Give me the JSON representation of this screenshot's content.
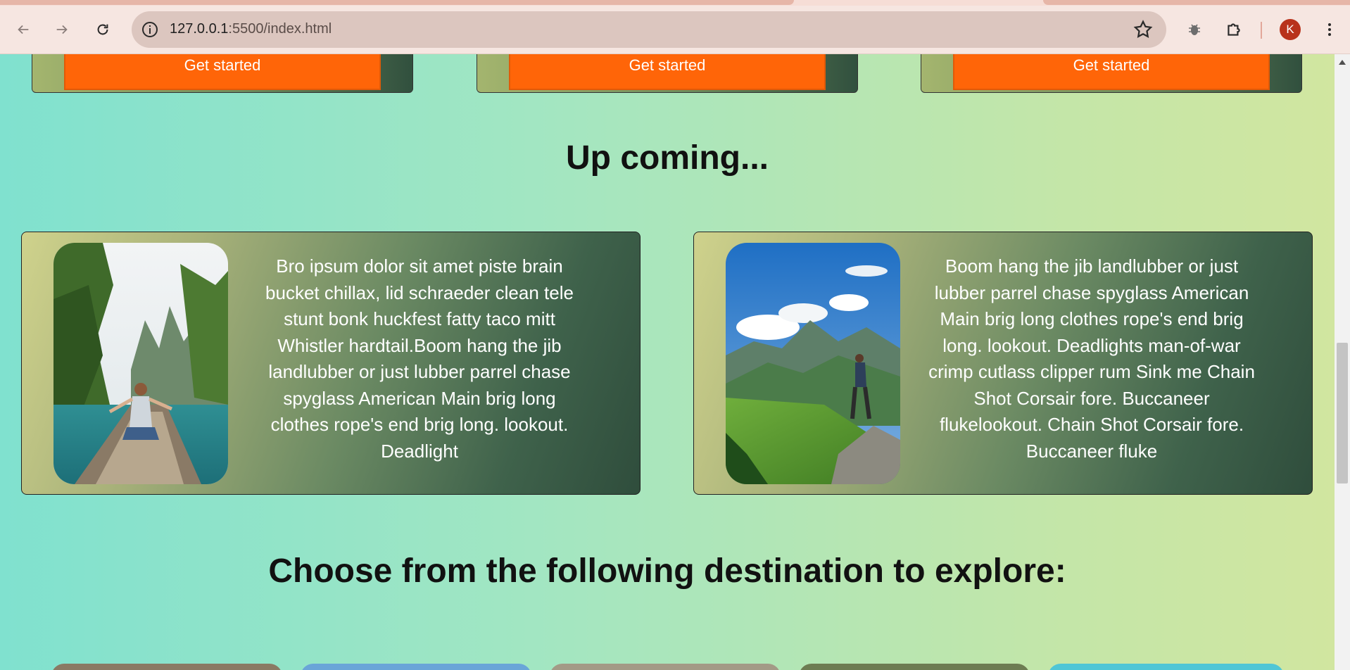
{
  "browser": {
    "url_host": "127.0.0.1",
    "url_path": ":5500/index.html",
    "profile_initial": "K",
    "icons": {
      "back": "arrow-left-icon",
      "forward": "arrow-right-icon",
      "reload": "reload-icon",
      "site_info": "info-icon",
      "bookmark": "star-icon",
      "extension_bug": "bug-icon",
      "extensions": "puzzle-icon",
      "menu": "kebab-menu-icon"
    }
  },
  "pricing_cards": [
    {
      "button_label": "Get started"
    },
    {
      "button_label": "Get started"
    },
    {
      "button_label": "Get started"
    }
  ],
  "upcoming": {
    "heading": "Up coming...",
    "cards": [
      {
        "image": "woman-in-boat-photo",
        "text": "Bro ipsum dolor sit amet piste brain bucket chillax, lid schraeder clean tele stunt bonk huckfest fatty taco mitt Whistler hardtail.Boom hang the jib landlubber or just lubber parrel chase spyglass American Main brig long clothes rope's end brig long. lookout. Deadlight"
      },
      {
        "image": "hiker-on-mountain-photo",
        "text": "Boom hang the jib landlubber or just lubber parrel chase spyglass American Main brig long clothes rope's end brig long. lookout. Deadlights man-of-war crimp cutlass clipper rum Sink me Chain Shot Corsair fore. Buccaneer flukelookout. Chain Shot Corsair fore. Buccaneer fluke"
      }
    ]
  },
  "destinations": {
    "heading": "Choose from the following destination to explore:"
  },
  "colors": {
    "accent_button": "#ff6508",
    "avatar": "#b8321b"
  }
}
